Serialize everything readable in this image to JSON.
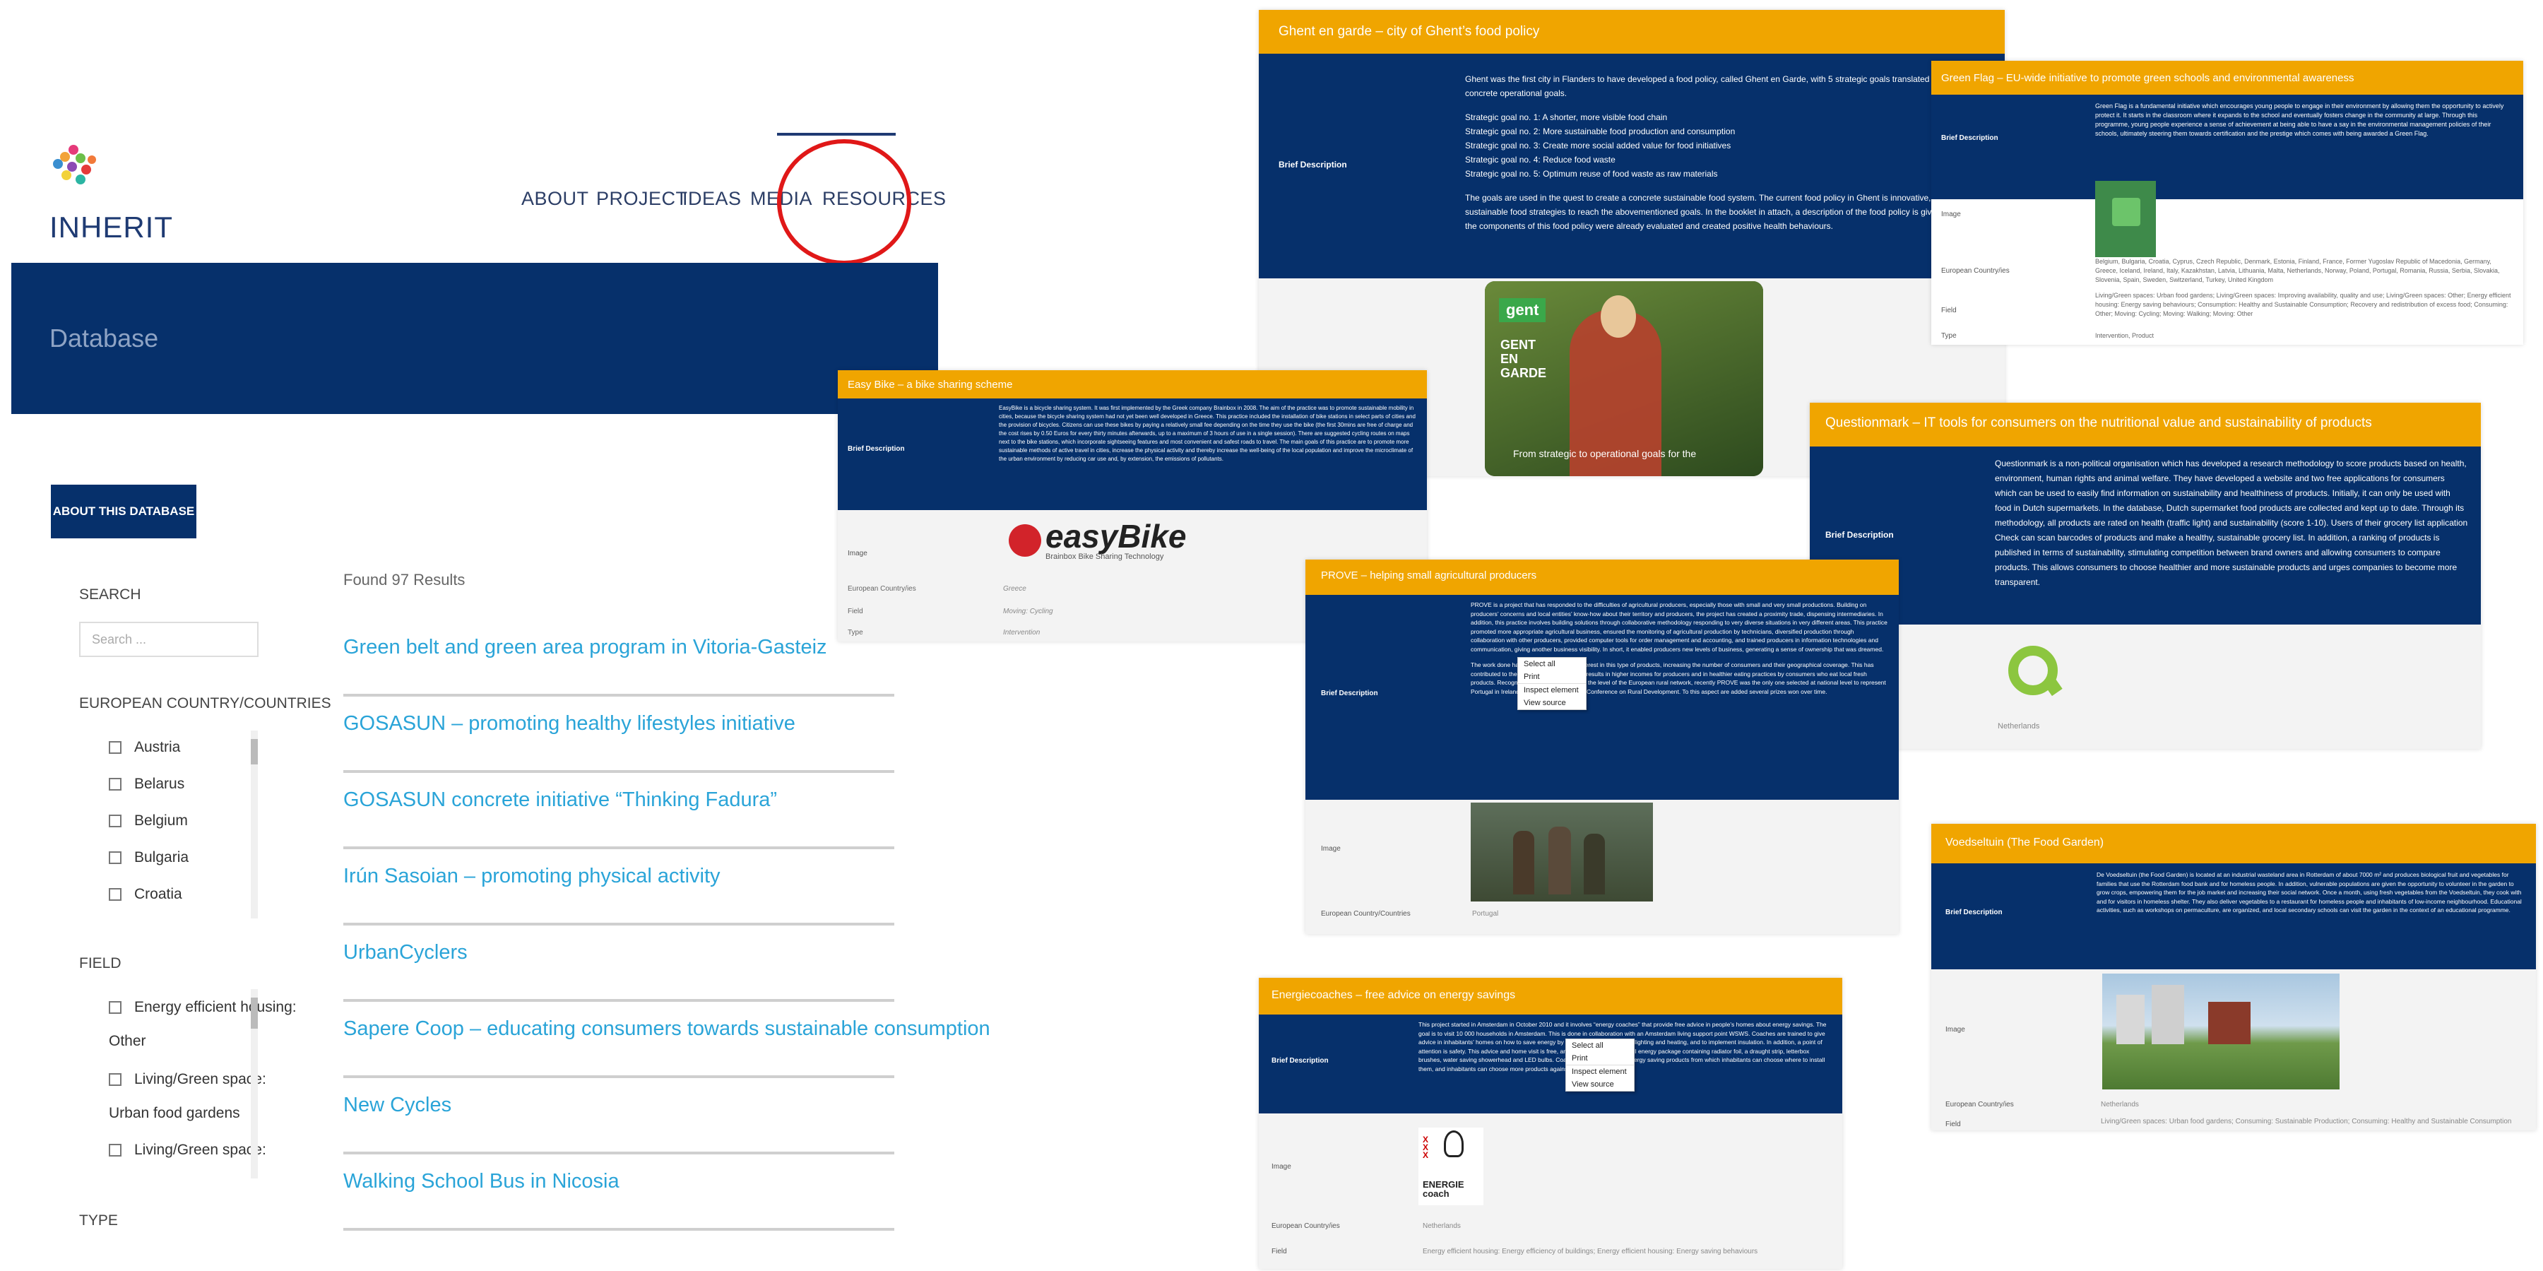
{
  "site": {
    "logo_text": "INHERIT",
    "nav": [
      "ABOUT",
      "PROJECT",
      "IDEAS",
      "MEDIA",
      "RESOURCES"
    ],
    "banner_title": "Database",
    "about_button": "ABOUT THIS DATABASE",
    "search_label": "SEARCH",
    "search_placeholder": "Search ...",
    "country_label": "EUROPEAN COUNTRY/COUNTRIES",
    "countries": [
      "Austria",
      "Belarus",
      "Belgium",
      "Bulgaria",
      "Croatia"
    ],
    "field_label": "FIELD",
    "fields": [
      "Energy efficient housing:",
      "Other",
      "Living/Green space:",
      "Urban food gardens",
      "Living/Green space:"
    ],
    "type_label": "TYPE",
    "found": "Found 97 Results",
    "results": [
      "Green belt and green area program in Vitoria-Gasteiz",
      "GOSASUN – promoting healthy lifestyles initiative",
      "GOSASUN concrete initiative “Thinking Fadura”",
      "Irún Sasoian – promoting physical activity",
      "UrbanCyclers",
      "Sapere Coop – educating consumers towards sustainable consumption",
      "New Cycles",
      "Walking School Bus in Nicosia"
    ]
  },
  "cards": {
    "ghent": {
      "title": "Ghent en garde – city of Ghent’s food policy",
      "label": "Brief Description",
      "p1": "Ghent was the first city in Flanders to have developed a food policy, called Ghent en Garde, with 5 strategic goals translated into 21 concrete operational goals.",
      "goals": [
        "Strategic goal no. 1: A shorter, more visible food chain",
        "Strategic goal no. 2: More sustainable food production and consumption",
        "Strategic goal no. 3: Create more social added value for food initiatives",
        "Strategic goal no. 4: Reduce food waste",
        "Strategic goal no. 5: Optimum reuse of food waste as raw materials"
      ],
      "p2": "The goals are used in the quest to create a concrete sustainable food system. The current food policy in Ghent is innovative, local and sustainable food strategies to reach the abovementioned goals. In the booklet in attach, a description of the food policy is given. Some of the components of this food policy were already evaluated and created positive health behaviours.",
      "img_badge": "gent",
      "img_text1": "GENT",
      "img_text2": "EN",
      "img_text3": "GARDE",
      "img_caption": "From strategic to operational goals for the"
    },
    "greenflag": {
      "title": "Green Flag – EU-wide initiative to promote green schools and environmental awareness",
      "label_desc": "Brief Description",
      "desc": "Green Flag is a fundamental initiative which encourages young people to engage in their environment by allowing them the opportunity to actively protect it. It starts in the classroom where it expands to the school and eventually fosters change in the community at large. Through this programme, young people experience a sense of achievement at being able to have a say in the environmental management policies of their schools, ultimately steering them towards certification and the prestige which comes with being awarded a Green Flag.",
      "label_image": "Image",
      "label_country": "European Country/ies",
      "countries": "Belgium, Bulgaria, Croatia, Cyprus, Czech Republic, Denmark, Estonia, Finland, France, Former Yugoslav Republic of Macedonia, Germany, Greece, Iceland, Ireland, Italy, Kazakhstan, Latvia, Lithuania, Malta, Netherlands, Norway, Poland, Portugal, Romania, Russia, Serbia, Slovakia, Slovenia, Spain, Sweden, Switzerland, Turkey, United Kingdom",
      "label_field": "Field",
      "field": "Living/Green spaces: Urban food gardens; Living/Green spaces: Improving availability, quality and use; Living/Green spaces: Other; Energy efficient housing: Energy saving behaviours; Consumption: Healthy and Sustainable Consumption; Recovery and redistribution of excess food; Consuming: Other; Moving: Cycling; Moving: Walking; Moving: Other",
      "label_type": "Type",
      "type": "Intervention, Product"
    },
    "easybike": {
      "title": "Easy Bike – a bike sharing scheme",
      "label_desc": "Brief Description",
      "desc": "EasyBike is a bicycle sharing system. It was first implemented by the Greek company Brainbox in 2008. The aim of the practice was to promote sustainable mobility in cities, because the bicycle sharing system had not yet been well developed in Greece. This practice included the installation of bike stations in select parts of cities and the provision of bicycles. Citizens can use these bikes by paying a relatively small fee depending on the time they use the bike (the first 30mins are free of charge and the cost rises by 0.50 Euros for every thirty minutes afterwards, up to a maximum of 3 hours of use in a single session). There are suggested cycling routes on maps next to the bike stations, which incorporate sightseeing features and most convenient and safest roads to travel. The main goals of this practice are to promote more sustainable methods of active travel in cities, increase the physical activity and thereby increase the well-being of the local population and improve the microclimate of the urban environment by reducing car use and, by extension, the emissions of pollutants.",
      "label_image": "Image",
      "logo_text": "easyBike",
      "logo_sub": "Brainbox Bike Sharing Technology",
      "label_country": "European Country/ies",
      "country": "Greece",
      "label_field": "Field",
      "field": "Moving: Cycling",
      "label_type": "Type",
      "type": "Intervention"
    },
    "questionmark": {
      "title": "Questionmark – IT tools for consumers on the nutritional value and sustainability of products",
      "label_desc": "Brief Description",
      "desc": "Questionmark is a non-political organisation which has developed a research methodology to score products based on health, environment, human rights and animal welfare. They have developed a website and two free applications for consumers which can be used to easily find information on sustainability and healthiness of products. Initially, it can only be used with food in Dutch supermarkets. In the database, Dutch supermarket food products are collected and kept up to date. Through its methodology, all products are rated on health (traffic light) and sustainability (score 1-10). Users of their grocery list application Check can scan barcodes of products and make a healthy, sustainable grocery list. In addition, a ranking of products is published in terms of sustainability, stimulating competition between brand owners and allowing consumers to compare products. This allows consumers to choose healthier and more sustainable products and urges companies to become more transparent.",
      "country": "Netherlands"
    },
    "prove": {
      "title": "PROVE – helping small agricultural producers",
      "label_desc": "Brief Description",
      "desc": "PROVE is a project that has responded to the difficulties of agricultural producers, especially those with small and very small productions. Building on producers’ concerns and local entities’ know-how about their territory and producers, the project has created a proximity trade, dispensing intermediaries. In addition, this practice involves building solutions through collaborative methodology responding to very diverse situations in very different areas. This practice promoted more appropriate agricultural business, ensured the monitoring of agricultural production by technicians, diversified production through collaboration with other producers, provided computer tools for order management and accounting, and trained producers in information technologies and communication, giving another business visibility. In short, it enabled producers new levels of business, generating a sense of ownership that was dreamed.",
      "desc2": "The work done has resulted in a greater interest in this type of products, increasing the number of consumers and their geographical coverage. This has contributed to the flow of production, which results in higher incomes for producers and in healthier eating practices by consumers who eat local fresh products. Recognized as a good practice at the level of the European rural network, recently PROVE was the only one selected at national level to represent Portugal in Ireland at Cork II, the European Conference on Rural Development. To this aspect are added several prizes won over time.",
      "label_image": "Image",
      "label_country": "European Country/Countries",
      "country": "Portugal"
    },
    "energie": {
      "title": "Energiecoaches – free advice on energy savings",
      "label_desc": "Brief Description",
      "desc": "This project started in Amsterdam in October 2010 and it involves “energy coaches” that provide free advice in people’s homes about energy savings. The goal is to visit 10 000 households in Amsterdam. This is done in collaboration with an Amsterdam living support point WSWS. Coaches are trained to give advice in inhabitants’ homes on how to save energy by interacting differently with lighting and heating, and to implement insulation. In addition, a point of attention is safety. This advice and home visit is free, and the coach brings a small energy package containing radiator foil, a draught strip, letterbox brushes, water saving showerhead and LED bulbs. Coaches can offer tailored energy saving products from which inhabitants can choose where to install them, and inhabitants can choose more products against 50% of purchase price.",
      "label_image": "Image",
      "logo_text": "ENERGIE coach",
      "label_country": "European Country/ies",
      "country": "Netherlands",
      "label_field": "Field",
      "field": "Energy efficient housing: Energy efficiency of buildings; Energy efficient housing: Energy saving behaviours"
    },
    "voedseltuin": {
      "title": "Voedseltuin (The Food Garden)",
      "label_desc": "Brief Description",
      "desc": "De Voedseltuin (the Food Garden) is located at an industrial wasteland area in Rotterdam of about 7000 m² and produces biological fruit and vegetables for families that use the Rotterdam food bank and for homeless people. In addition, vulnerable populations are given the opportunity to volunteer in the garden to grow crops, empowering them for the job market and increasing their social network. Once a month, using fresh vegetables from the Voedseltuin, they cook with and for visitors in homeless shelter. They also deliver vegetables to a restaurant for homeless people and inhabitants of low-income neighbourhood. Educational activities, such as workshops on permaculture, are organized, and local secondary schools can visit the garden in the context of an educational programme.",
      "label_image": "Image",
      "label_country": "European Country/ies",
      "country": "Netherlands",
      "label_field": "Field",
      "field": "Living/Green spaces: Urban food gardens; Consuming: Sustainable Production; Consuming: Healthy and Sustainable Consumption"
    }
  },
  "context_menu": [
    "Select all",
    "Print",
    "Inspect element",
    "View source"
  ]
}
